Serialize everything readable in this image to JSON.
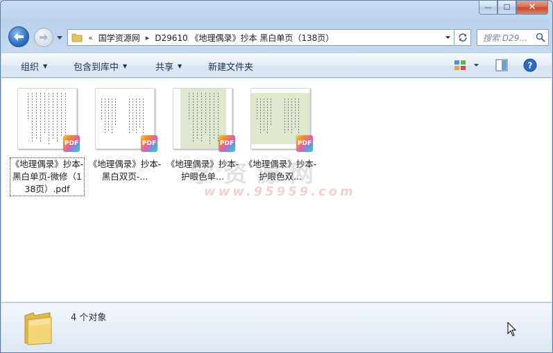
{
  "window": {
    "minimize_glyph": "—",
    "maximize_glyph": "☐",
    "close_glyph": "✕"
  },
  "address_bar": {
    "overflow_glyph": "«",
    "crumbs": [
      "国学资源网",
      "D29610 《地理偶录》抄本 黑白单页（138页）"
    ],
    "separator": "▸"
  },
  "search": {
    "placeholder": "搜索 D29..."
  },
  "toolbar": {
    "organize": "组织",
    "include_in_library": "包含到库中",
    "share": "共享",
    "new_folder": "新建文件夹"
  },
  "files": [
    {
      "label": "《地理偶录》抄本-黑白单页-微修（138页）.pdf",
      "badge": "PDF",
      "style": "white-single",
      "selected": true
    },
    {
      "label": "《地理偶录》抄本-黑白双页-...",
      "badge": "PDF",
      "style": "white-double",
      "selected": false
    },
    {
      "label": "《地理偶录》抄本-护眼色单...",
      "badge": "PDF",
      "style": "green-single",
      "selected": false
    },
    {
      "label": "《地理偶录》抄本-护眼色双...",
      "badge": "PDF",
      "style": "green-double",
      "selected": false
    }
  ],
  "watermark": {
    "line1": "学资源网",
    "line2": "www.95959.com"
  },
  "details": {
    "count_text": "4 个对象"
  },
  "colors": {
    "eye_care_green": "#dfe8cf",
    "accent": "#2e6fc0"
  }
}
